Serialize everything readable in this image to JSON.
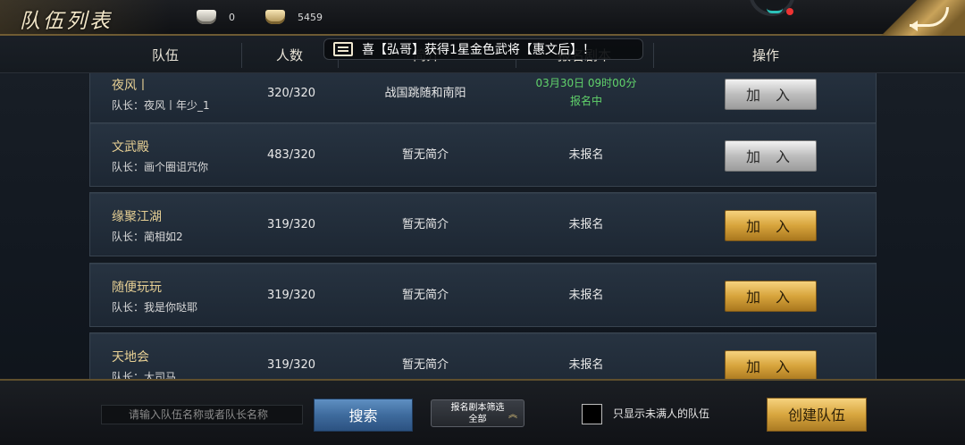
{
  "topbar": {
    "title": "队伍列表",
    "currency_silver": "0",
    "currency_gold": "5459",
    "icons": {
      "silver": "silver-ingot-icon",
      "gold": "gold-ingot-icon",
      "back": "back-arrow-icon"
    }
  },
  "header": {
    "col_team": "队伍",
    "col_count": "人数",
    "col_intro": "简介",
    "col_script": "报名剧本",
    "col_action": "操作"
  },
  "ticker": {
    "text": "喜【弘哥】获得1星金色武将【惠文后】！"
  },
  "rows": [
    {
      "name": "夜风丨",
      "leader": "队长：夜风丨年少_1",
      "count": "320/320",
      "intro": "战国跳随和南阳",
      "status_line1": "03月30日 09时00分",
      "status_line2": "报名中",
      "button": "加 入",
      "style": "silver"
    },
    {
      "name": "文武殿",
      "leader": "队长：画个圈诅咒你",
      "count": "483/320",
      "intro": "暂无简介",
      "status": "未报名",
      "button": "加 入",
      "style": "silver"
    },
    {
      "name": "缘聚江湖",
      "leader": "队长：蔺相如2",
      "count": "319/320",
      "intro": "暂无简介",
      "status": "未报名",
      "button": "加 入",
      "style": "gold"
    },
    {
      "name": "随便玩玩",
      "leader": "队长：我是你哒耶",
      "count": "319/320",
      "intro": "暂无简介",
      "status": "未报名",
      "button": "加 入",
      "style": "gold"
    },
    {
      "name": "天地会",
      "leader": "队长：大司马",
      "count": "319/320",
      "intro": "暂无简介",
      "status": "未报名",
      "button": "加 入",
      "style": "gold"
    }
  ],
  "bottom": {
    "search_placeholder": "请输入队伍名称或者队长名称",
    "search_button": "搜索",
    "filter_line1": "报名剧本筛选",
    "filter_line2": "全部",
    "only_not_full": "只显示未满人的队伍",
    "create_button": "创建队伍"
  },
  "colors": {
    "gold_text": "#e6cf94",
    "green": "#61d36b",
    "accent_gold": "#d7a43c",
    "blue_button": "#3e6b9d"
  }
}
